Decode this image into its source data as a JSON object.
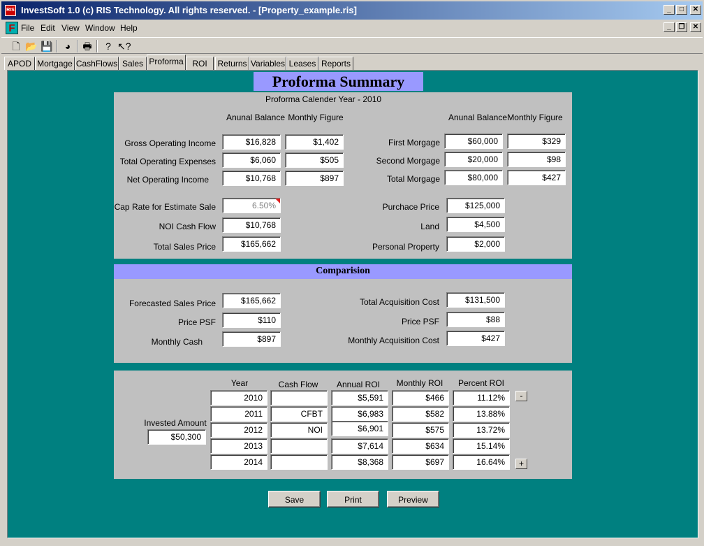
{
  "window": {
    "title": "InvestSoft 1.0 (c) RIS Technology. All rights reserved. - [Property_example.ris]",
    "app_icon_label": "RIS"
  },
  "menu": [
    "File",
    "Edit",
    "View",
    "Window",
    "Help"
  ],
  "toolbar_icons": [
    "new-file-icon",
    "open-folder-icon",
    "save-icon",
    "color-palette-icon",
    "print-icon",
    "help-icon",
    "context-help-icon"
  ],
  "tabs": [
    "APOD",
    "Mortgage",
    "CashFlows",
    "Sales",
    "Proforma",
    "ROI",
    "Returns",
    "Variables",
    "Leases",
    "Reports"
  ],
  "active_tab": "Proforma",
  "summary": {
    "title": "Proforma Summary",
    "calendar_year_label": "Proforma Calender Year -  2010",
    "col_annual": "Anunal Balance",
    "col_monthly": "Monthly Figure",
    "income_rows": [
      {
        "label": "Gross Operating Income",
        "annual": "$16,828",
        "monthly": "$1,402"
      },
      {
        "label": "Total Operating Expenses",
        "annual": "$6,060",
        "monthly": "$505"
      },
      {
        "label": "Net Operating Income",
        "annual": "$10,768",
        "monthly": "$897"
      }
    ],
    "mortgage_rows": [
      {
        "label": "First Morgage",
        "annual": "$60,000",
        "monthly": "$329"
      },
      {
        "label": "Second Morgage",
        "annual": "$20,000",
        "monthly": "$98"
      },
      {
        "label": "Total Morgage",
        "annual": "$80,000",
        "monthly": "$427"
      }
    ],
    "sale_rows": [
      {
        "label": "Cap Rate for Estimate Sale",
        "value": "6.50%"
      },
      {
        "label": "NOI Cash Flow",
        "value": "$10,768"
      },
      {
        "label": "Total Sales Price",
        "value": "$165,662"
      }
    ],
    "purchase_rows": [
      {
        "label": "Purchace Price",
        "value": "$125,000"
      },
      {
        "label": "Land",
        "value": "$4,500"
      },
      {
        "label": "Personal Property",
        "value": "$2,000"
      }
    ]
  },
  "comparison": {
    "title": "Comparision",
    "left_rows": [
      {
        "label": "Forecasted Sales Price",
        "value": "$165,662"
      },
      {
        "label": "Price PSF",
        "value": "$110"
      },
      {
        "label": "Monthly Cash",
        "value": "$897"
      }
    ],
    "right_rows": [
      {
        "label": "Total Acquisition Cost",
        "value": "$131,500"
      },
      {
        "label": "Price PSF",
        "value": "$88"
      },
      {
        "label": "Monthly Acquisition Cost",
        "value": "$427"
      }
    ]
  },
  "roi": {
    "invested_label": "Invested Amount",
    "invested_value": "$50,300",
    "headers": [
      "Year",
      "Cash Flow",
      "Annual ROI",
      "Monthly ROI",
      "Percent ROI"
    ],
    "rows": [
      [
        "2010",
        "",
        "$5,591",
        "$466",
        "11.12%"
      ],
      [
        "2011",
        "CFBT",
        "$6,983",
        "$582",
        "13.88%"
      ],
      [
        "2012",
        "NOI",
        "$6,901",
        "$575",
        "13.72%"
      ],
      [
        "2013",
        "",
        "$7,614",
        "$634",
        "15.14%"
      ],
      [
        "2014",
        "",
        "$8,368",
        "$697",
        "16.64%"
      ]
    ],
    "minus_label": "-",
    "plus_label": "+"
  },
  "buttons": {
    "save": "Save",
    "print": "Print",
    "preview": "Preview"
  }
}
